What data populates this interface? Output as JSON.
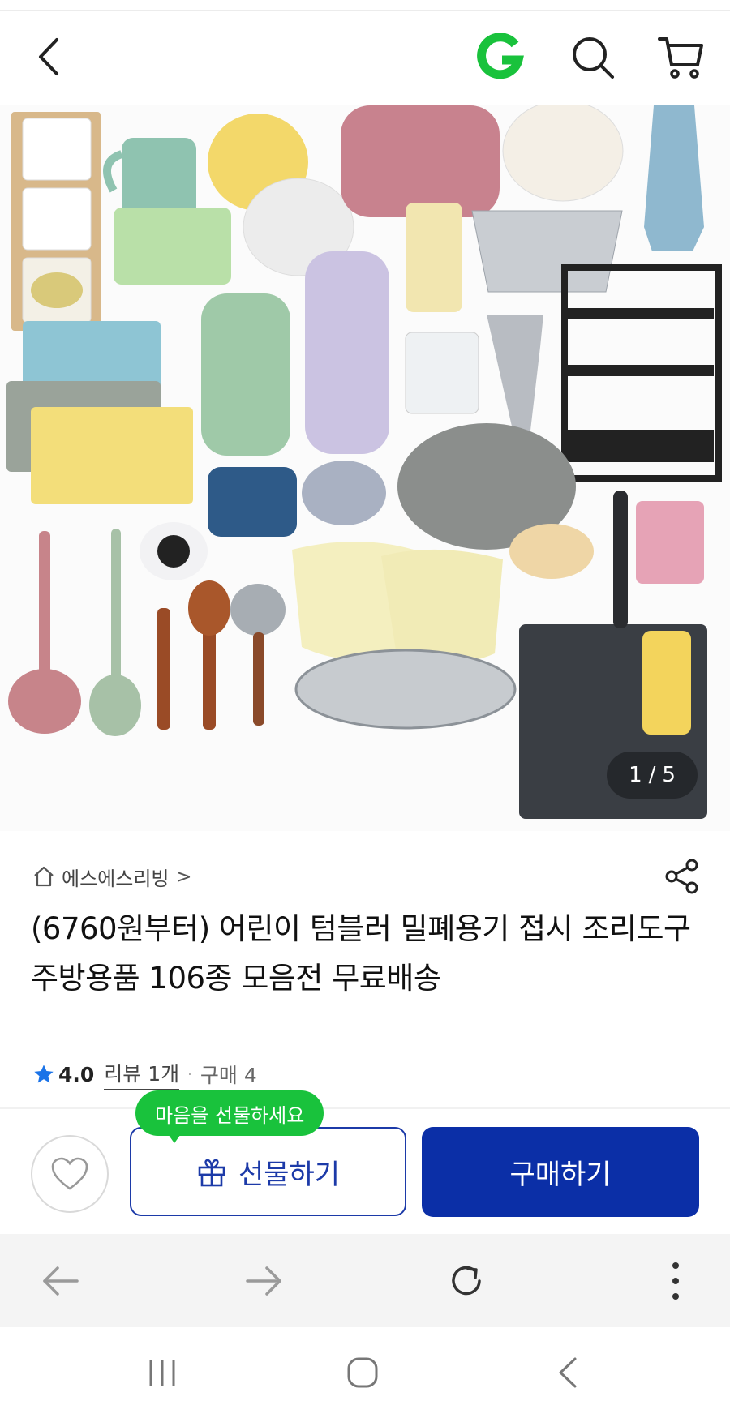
{
  "header": {
    "back_icon": "chevron-left-icon",
    "logo_letter": "G",
    "logo_color": "#19c23c",
    "search_icon": "search-icon",
    "cart_icon": "cart-icon"
  },
  "product_image": {
    "counter_current": "1",
    "counter_separator": "/",
    "counter_total": "5"
  },
  "store": {
    "name": "에스에스리빙",
    "chevron": ">"
  },
  "product": {
    "title": "(6760원부터) 어린이 텀블러 밀폐용기 접시 조리도구 주방용품 106종 모음전 무료배송"
  },
  "rating": {
    "score": "4.0",
    "review_label": "리뷰 1개",
    "separator": "·",
    "purchase_label": "구매 4",
    "star_color": "#1a73e8"
  },
  "actions": {
    "tooltip": "마음을 선물하세요",
    "gift_label": "선물하기",
    "buy_label": "구매하기",
    "primary_color": "#0b2fa7"
  },
  "browser": {
    "back_icon": "arrow-left-icon",
    "forward_icon": "arrow-right-icon",
    "reload_icon": "reload-icon",
    "menu_icon": "more-vertical-icon"
  },
  "system_nav": {
    "recents_icon": "recents-icon",
    "home_icon": "home-icon",
    "back_icon": "back-icon"
  }
}
